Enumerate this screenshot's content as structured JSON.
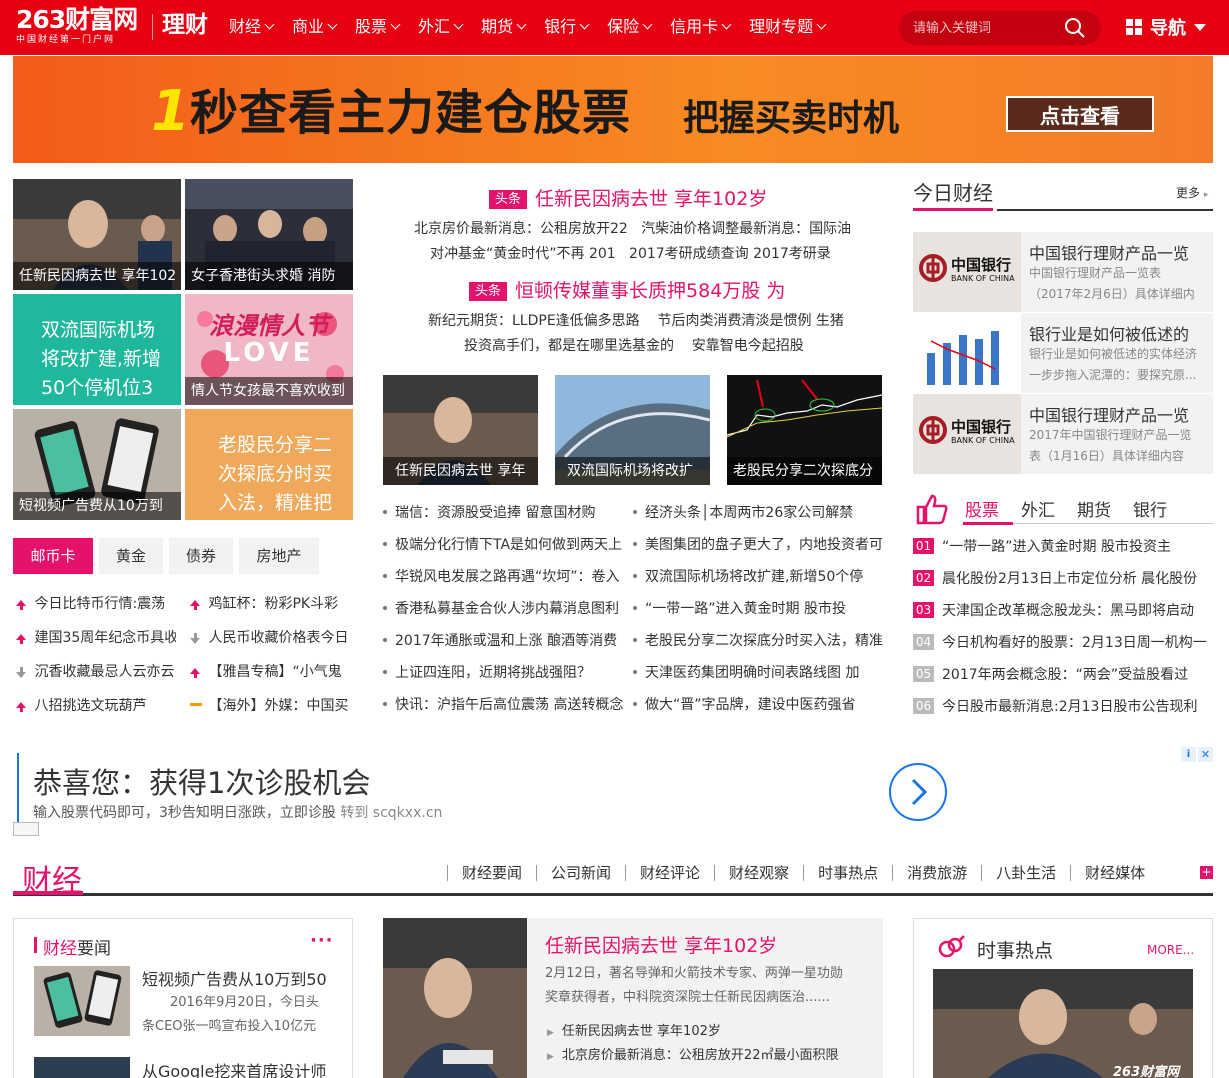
{
  "header": {
    "logo_main": "263财富网",
    "logo_sub": "中国财经第一门户网",
    "channel": "理财",
    "nav": [
      "财经",
      "商业",
      "股票",
      "外汇",
      "期货",
      "银行",
      "保险",
      "信用卡",
      "理财专题"
    ],
    "search_placeholder": "请输入关键词",
    "guide_label": "导航"
  },
  "banner": {
    "num": "1",
    "text": "秒查看主力建仓股票",
    "text2": "把握买卖时机",
    "button": "点击查看"
  },
  "left_tiles": {
    "t1": "任新民因病去世 享年102",
    "t2": "女子香港街头求婚 消防",
    "t3": "双流国际机场将改扩建,新增50个停机位3",
    "t4_title": "浪漫情人节",
    "t4_love": "LOVE",
    "t4": "情人节女孩最不喜欢收到",
    "t5": "短视频广告费从10万到",
    "t6": "老股民分享二次探底分时买入法，精准把"
  },
  "left_tabs": [
    "邮币卡",
    "黄金",
    "债券",
    "房地产"
  ],
  "left_rank": [
    {
      "a": "今日比特币行情:震荡",
      "b": "鸡缸杯：粉彩PK斗彩"
    },
    {
      "a": "建国35周年纪念币具收",
      "b": "人民币收藏价格表今日"
    },
    {
      "a": "沉香收藏最忌人云亦云",
      "b": "【雅昌专稿】“小气鬼"
    },
    {
      "a": "八招挑选文玩葫芦",
      "b": "【海外】外媒：中国买"
    }
  ],
  "center": {
    "tag": "头条",
    "h1": "任新民因病去世 享年102岁",
    "sub1a": "北京房价最新消息：公租房放开22",
    "sub1b": "汽柴油价格调整最新消息：国际油",
    "sub2a": "对冲基金“黄金时代”不再 201",
    "sub2b": "2017考研成绩查询 2017考研录",
    "h2": "恒顿传媒董事长质押584万股 为",
    "sub3a": "新纪元期货：LLDPE逢低偏多思路",
    "sub3b": "节后肉类消费清淡是惯例 生猪",
    "sub4a": "投资高手们，都是在哪里选基金的",
    "sub4b": "安靠智电今起招股",
    "pic1": "任新民因病去世 享年",
    "pic2": "双流国际机场将改扩",
    "pic3": "老股民分享二次探底分",
    "list_left": [
      "瑞信：资源股受追捧 留意国材购",
      "极端分化行情下TA是如何做到两天上",
      "华锐风电发展之路再遇“坎坷”：卷入",
      "香港私募基金合伙人涉内幕消息图利",
      "2017年通胀或温和上涨 酿酒等消费",
      "上证四连阳，近期将挑战强阻？",
      "快讯：沪指午后高位震荡 高送转概念"
    ],
    "list_right": [
      "经济头条│本周两市26家公司解禁",
      "美图集团的盘子更大了，内地投资者可",
      "双流国际机场将改扩建,新增50个停",
      "“一带一路”进入黄金时期 股市投",
      "老股民分享二次探底分时买入法，精准",
      "天津医药集团明确时间表路线图 加",
      "做大“晋”字品牌，建设中医药强省"
    ]
  },
  "right": {
    "title": "今日财经",
    "more": "更多",
    "news": [
      {
        "title": "中国银行理财产品一览",
        "d1": "中国银行理财产品一览表",
        "d2": "（2017年2月6日）具体详细内"
      },
      {
        "title": "银行业是如何被低述的",
        "d1": "银行业是如何被低述的实体经济",
        "d2": "一步步拖入泥潭的：要探究原..."
      },
      {
        "title": "中国银行理财产品一览",
        "d1": "2017年中国银行理财产品一览",
        "d2": "表（1月16日）具体详细内容"
      }
    ],
    "bank_logo_cn": "中国银行",
    "bank_logo_en": "BANK OF CHINA",
    "tabs": [
      "股票",
      "外汇",
      "期货",
      "银行"
    ],
    "rank": [
      {
        "n": "01",
        "t": "“一带一路”进入黄金时期 股市投资主"
      },
      {
        "n": "02",
        "t": "晨化股份2月13日上市定位分析 晨化股份"
      },
      {
        "n": "03",
        "t": "天津国企改革概念股龙头：黑马即将启动"
      },
      {
        "n": "04",
        "t": "今日机构看好的股票：2月13日周一机构一"
      },
      {
        "n": "05",
        "t": "2017年两会概念股：“两会”受益股看过"
      },
      {
        "n": "06",
        "t": "今日股市最新消息:2月13日股市公告现利"
      }
    ]
  },
  "ad": {
    "title": "恭喜您：获得1次诊股机会",
    "sub": "输入股票代码即可，3秒告知明日涨跌，立即诊股",
    "link": "转到 scqkxx.cn"
  },
  "section2": {
    "title": "财经",
    "nav": [
      "财经要闻",
      "公司新闻",
      "财经评论",
      "财经观察",
      "时事热点",
      "消费旅游",
      "八卦生活",
      "财经媒体"
    ],
    "box1_title_a": "财经",
    "box1_title_b": "要闻",
    "box1_more": "···",
    "item1_title": "短视频广告费从10万到50",
    "item1_desc1": "2016年9月20日，今日头",
    "item1_desc2": "条CEO张一鸣宣布投入10亿元",
    "item2_title": "从Google挖来首席设计师",
    "feature_title": "任新民因病去世 享年102岁",
    "feature_desc1": "2月12日，著名导弹和火箭技术专家、两弹一星功勋",
    "feature_desc2": "奖章获得者，中科院资深院士任新民因病医治......",
    "feature_links": [
      "任新民因病去世 享年102岁",
      "北京房价最新消息：公租房放开22㎡最小面积限"
    ],
    "hot_title": "时事热点",
    "hot_more": "MORE...",
    "watermark": "263财富网"
  }
}
